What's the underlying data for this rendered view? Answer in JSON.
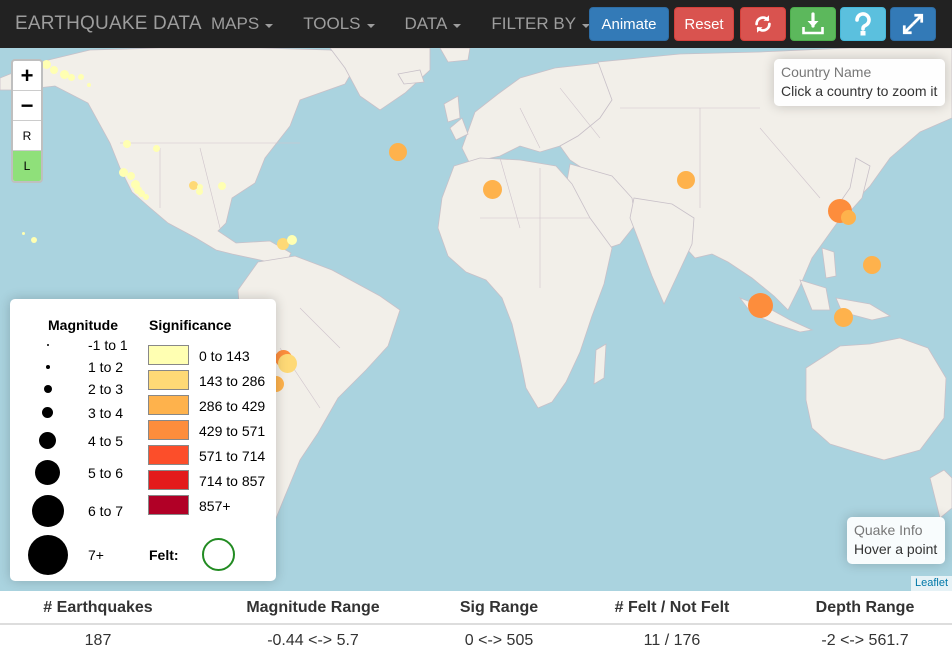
{
  "navbar": {
    "brand": "EARTHQUAKE DATA",
    "menus": [
      "MAPS",
      "TOOLS",
      "DATA",
      "FILTER BY"
    ],
    "animate_label": "Animate",
    "reset_label": "Reset",
    "icons": [
      "refresh-icon",
      "download-icon",
      "help-icon",
      "expand-icon"
    ]
  },
  "map": {
    "zoom_in": "+",
    "zoom_out": "−",
    "layer_r": "R",
    "layer_l": "L",
    "country_info": {
      "title": "Country Name",
      "hint": "Click a country to zoom it"
    },
    "quake_info": {
      "title": "Quake Info",
      "hint": "Hover a point"
    },
    "attribution": "Leaflet",
    "colors": {
      "ocean": "#aad3df",
      "land": "#f2efe9",
      "border": "#c8c0c8"
    }
  },
  "legend": {
    "magnitude_title": "Magnitude",
    "significance_title": "Significance",
    "magnitude": [
      "-1 to 1",
      "1 to 2",
      "2 to 3",
      "3 to 4",
      "4 to 5",
      "5 to 6",
      "6 to 7",
      "7+"
    ],
    "significance": [
      {
        "label": "0 to 143",
        "color": "#ffffb2"
      },
      {
        "label": "143 to 286",
        "color": "#fed976"
      },
      {
        "label": "286 to 429",
        "color": "#feb24c"
      },
      {
        "label": "429 to 571",
        "color": "#fd8d3c"
      },
      {
        "label": "571 to 714",
        "color": "#fc4e2a"
      },
      {
        "label": "714 to 857",
        "color": "#e31a1c"
      },
      {
        "label": "857+",
        "color": "#b10026"
      }
    ],
    "felt_label": "Felt:"
  },
  "stats": {
    "headers": [
      "# Earthquakes",
      "Magnitude Range",
      "Sig Range",
      "# Felt / Not Felt",
      "Depth Range"
    ],
    "values": [
      "187",
      "-0.44 <-> 5.7",
      "0 <-> 505",
      "11 / 176",
      "-2 <-> 561.7"
    ]
  }
}
